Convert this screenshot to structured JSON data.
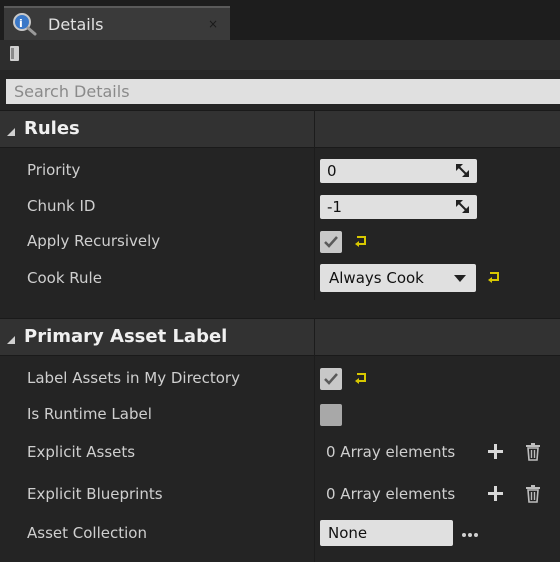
{
  "tab": {
    "title": "Details",
    "close_glyph": "×"
  },
  "icons": {
    "details": "magnifier-icon",
    "lock": "lock-icon",
    "reset": "reset-to-default-icon",
    "add": "plus-icon",
    "remove": "trash-icon",
    "browse": "ellipsis-icon"
  },
  "search": {
    "placeholder": "Search Details"
  },
  "categories": [
    {
      "title": "Rules",
      "properties": [
        {
          "label": "Priority",
          "value": "0"
        },
        {
          "label": "Chunk ID",
          "value": "-1"
        },
        {
          "label": "Apply Recursively",
          "checked": true
        },
        {
          "label": "Cook Rule",
          "value": "Always Cook"
        }
      ]
    },
    {
      "title": "Primary Asset Label",
      "properties": [
        {
          "label": "Label Assets in My Directory",
          "checked": true
        },
        {
          "label": "Is Runtime Label",
          "checked": false
        },
        {
          "label": "Explicit Assets",
          "value": "0 Array elements"
        },
        {
          "label": "Explicit Blueprints",
          "value": "0 Array elements"
        },
        {
          "label": "Asset Collection",
          "value": "None"
        }
      ]
    }
  ],
  "colors": {
    "reset_yellow": "#d8c800",
    "panel_bg": "#242424",
    "field_bg": "#e0e0e0"
  }
}
